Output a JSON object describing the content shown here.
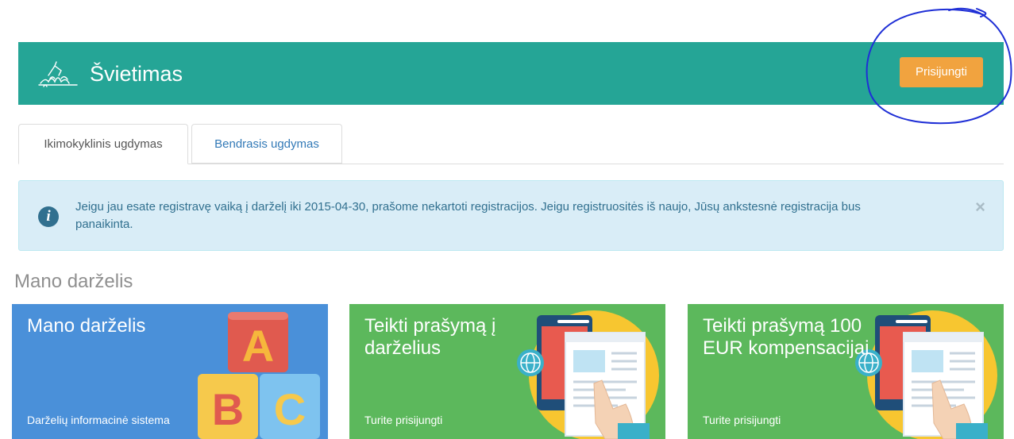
{
  "header": {
    "brand": "Švietimas",
    "login_label": "Prisijungti",
    "bg_color": "#25a596",
    "login_color": "#f1a33f"
  },
  "tabs": [
    {
      "label": "Ikimokyklinis ugdymas",
      "active": true
    },
    {
      "label": "Bendrasis ugdymas",
      "active": false
    }
  ],
  "alert": {
    "icon": "info-icon",
    "text": "Jeigu jau esate registravę vaiką į darželį iki 2015-04-30, prašome nekartoti registracijos. Jeigu registruositės iš naujo, Jūsų ankstesnė registracija bus panaikinta.",
    "close_label": "×"
  },
  "section": {
    "title": "Mano darželis"
  },
  "cards": [
    {
      "title": "Mano darželis",
      "subtitle": "Darželių informacinė sistema",
      "color": "#4a90d9",
      "icon": "abc-blocks-icon"
    },
    {
      "title": "Teikti prašymą į darželius",
      "subtitle": "Turite prisijungti",
      "color": "#5cb85c",
      "icon": "online-form-icon"
    },
    {
      "title": "Teikti prašymą 100 EUR kompensacijai",
      "subtitle": "Turite prisijungti",
      "color": "#5cb85c",
      "icon": "online-form-icon"
    }
  ]
}
